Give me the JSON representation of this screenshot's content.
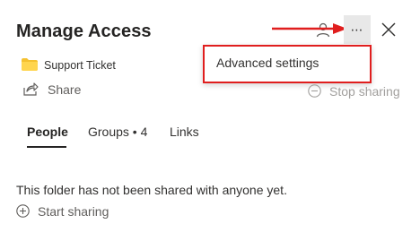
{
  "panel": {
    "title": "Manage Access",
    "folder_name": "Support Ticket",
    "share_label": "Share",
    "stop_sharing_label": "Stop sharing"
  },
  "menu": {
    "items": [
      {
        "label": "Advanced settings"
      }
    ]
  },
  "tabs": [
    {
      "label": "People",
      "active": true
    },
    {
      "label": "Groups • 4",
      "active": false
    },
    {
      "label": "Links",
      "active": false
    }
  ],
  "people": {
    "empty_message": "This folder has not been shared with anyone yet.",
    "start_sharing_label": "Start sharing"
  },
  "icons": {
    "more": "⋯",
    "person": "person-icon",
    "close": "close-icon",
    "folder": "folder-icon",
    "share": "share-icon",
    "stop": "stop-icon",
    "add": "add-circle-icon"
  },
  "colors": {
    "annotation_red": "#e01e1e",
    "folder_yellow": "#f5c131",
    "text_primary": "#252423",
    "text_disabled": "#a19f9d"
  }
}
